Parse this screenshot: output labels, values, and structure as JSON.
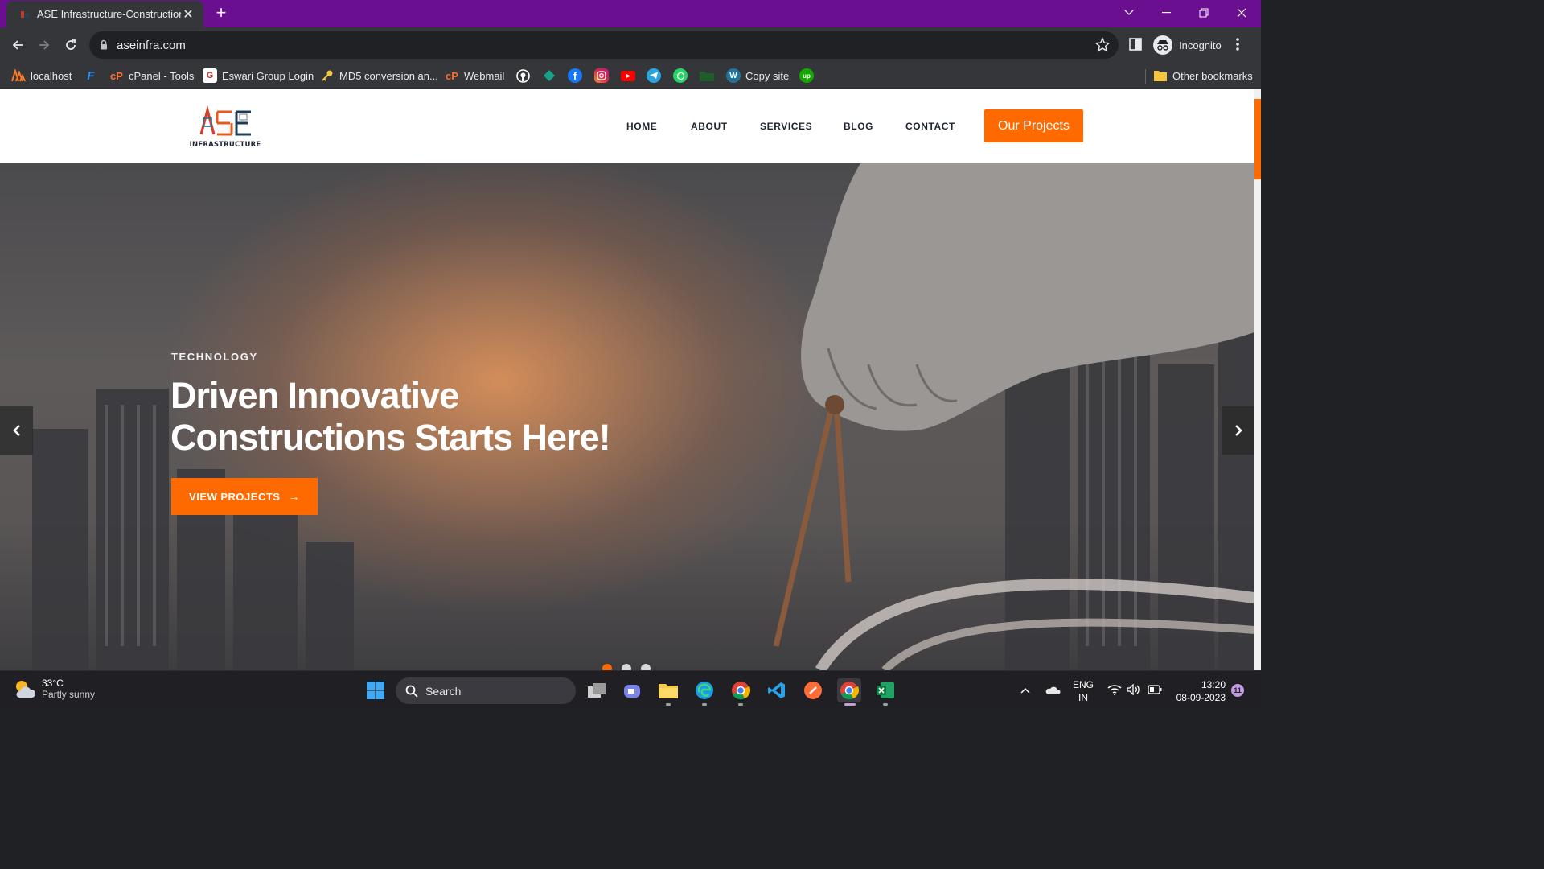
{
  "browser": {
    "tab_title": "ASE Infrastructure-Construction C",
    "tab_close": "✕",
    "new_tab": "+",
    "url": "aseinfra.com",
    "profile_label": "Incognito",
    "frame_color": "#6a0f8f"
  },
  "bookmarks": {
    "items": [
      {
        "label": "localhost",
        "icon": "xampp-icon"
      },
      {
        "label": "",
        "icon": "figma-f-icon"
      },
      {
        "label": "cPanel - Tools",
        "icon": "cpanel-icon"
      },
      {
        "label": "Eswari Group Login",
        "icon": "eswari-icon"
      },
      {
        "label": "MD5 conversion an...",
        "icon": "key-icon"
      },
      {
        "label": "Webmail",
        "icon": "cpanel-icon"
      },
      {
        "label": "",
        "icon": "github-icon"
      },
      {
        "label": "",
        "icon": "diamond-icon"
      },
      {
        "label": "",
        "icon": "facebook-icon"
      },
      {
        "label": "",
        "icon": "instagram-icon"
      },
      {
        "label": "",
        "icon": "youtube-icon"
      },
      {
        "label": "",
        "icon": "telegram-icon"
      },
      {
        "label": "",
        "icon": "whatsapp-icon"
      },
      {
        "label": "",
        "icon": "folder-icon"
      },
      {
        "label": "Copy site",
        "icon": "wordpress-icon"
      },
      {
        "label": "",
        "icon": "upwork-icon"
      }
    ],
    "other": "Other bookmarks"
  },
  "site": {
    "logo_text": "INFRASTRUCTURE",
    "logo_letters": "ASE",
    "nav": [
      "HOME",
      "ABOUT",
      "SERVICES",
      "BLOG",
      "CONTACT"
    ],
    "cta": "Our Projects",
    "accent": "#ff6a00"
  },
  "hero": {
    "tag": "TECHNOLOGY",
    "title_line1": "Driven Innovative",
    "title_line2": "Constructions Starts Here!",
    "button": "VIEW PROJECTS",
    "button_arrow": "→",
    "prev": "‹",
    "next": "›",
    "active_slide": 1,
    "slide_count": 3
  },
  "taskbar": {
    "temp": "33°C",
    "condition": "Partly sunny",
    "search": "Search",
    "lang_line1": "ENG",
    "lang_line2": "IN",
    "time": "13:20",
    "date": "08-09-2023",
    "notifications": "11"
  }
}
